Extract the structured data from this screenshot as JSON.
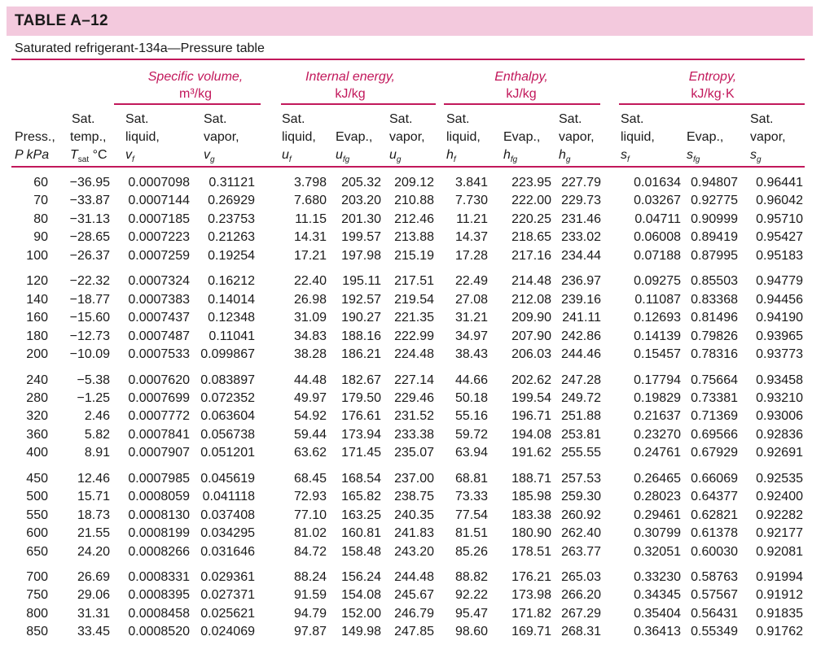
{
  "title": "TABLE A–12",
  "subtitle": "Saturated refrigerant-134a—Pressure table",
  "groups": {
    "specific_volume": {
      "name": "Specific volume,",
      "unit": "m³/kg"
    },
    "internal_energy": {
      "name": "Internal energy,",
      "unit": "kJ/kg"
    },
    "enthalpy": {
      "name": "Enthalpy,",
      "unit": "kJ/kg"
    },
    "entropy": {
      "name": "Entropy,",
      "unit": "kJ/kg·K"
    }
  },
  "headers": {
    "press": [
      "Press.,",
      "P kPa"
    ],
    "temp": [
      "Sat.",
      "temp.,",
      "T",
      "sat",
      " °C"
    ],
    "vf": [
      "Sat.",
      "liquid,",
      "v",
      "f"
    ],
    "vg": [
      "Sat.",
      "vapor,",
      "v",
      "g"
    ],
    "uf": [
      "Sat.",
      "liquid,",
      "u",
      "f"
    ],
    "ufg": [
      "Evap.,",
      "u",
      "fg"
    ],
    "ug": [
      "Sat.",
      "vapor,",
      "u",
      "g"
    ],
    "hf": [
      "Sat.",
      "liquid,",
      "h",
      "f"
    ],
    "hfg": [
      "Evap.,",
      "h",
      "fg"
    ],
    "hg": [
      "Sat.",
      "vapor,",
      "h",
      "g"
    ],
    "sf": [
      "Sat.",
      "liquid,",
      "s",
      "f"
    ],
    "sfg": [
      "Evap.,",
      "s",
      "fg"
    ],
    "sg": [
      "Sat.",
      "vapor,",
      "s",
      "g"
    ]
  },
  "rows": [
    [
      "60",
      "−36.95",
      "0.0007098",
      "0.31121",
      "3.798",
      "205.32",
      "209.12",
      "3.841",
      "223.95",
      "227.79",
      "0.01634",
      "0.94807",
      "0.96441"
    ],
    [
      "70",
      "−33.87",
      "0.0007144",
      "0.26929",
      "7.680",
      "203.20",
      "210.88",
      "7.730",
      "222.00",
      "229.73",
      "0.03267",
      "0.92775",
      "0.96042"
    ],
    [
      "80",
      "−31.13",
      "0.0007185",
      "0.23753",
      "11.15",
      "201.30",
      "212.46",
      "11.21",
      "220.25",
      "231.46",
      "0.04711",
      "0.90999",
      "0.95710"
    ],
    [
      "90",
      "−28.65",
      "0.0007223",
      "0.21263",
      "14.31",
      "199.57",
      "213.88",
      "14.37",
      "218.65",
      "233.02",
      "0.06008",
      "0.89419",
      "0.95427"
    ],
    [
      "100",
      "−26.37",
      "0.0007259",
      "0.19254",
      "17.21",
      "197.98",
      "215.19",
      "17.28",
      "217.16",
      "234.44",
      "0.07188",
      "0.87995",
      "0.95183"
    ],
    [
      "120",
      "−22.32",
      "0.0007324",
      "0.16212",
      "22.40",
      "195.11",
      "217.51",
      "22.49",
      "214.48",
      "236.97",
      "0.09275",
      "0.85503",
      "0.94779"
    ],
    [
      "140",
      "−18.77",
      "0.0007383",
      "0.14014",
      "26.98",
      "192.57",
      "219.54",
      "27.08",
      "212.08",
      "239.16",
      "0.11087",
      "0.83368",
      "0.94456"
    ],
    [
      "160",
      "−15.60",
      "0.0007437",
      "0.12348",
      "31.09",
      "190.27",
      "221.35",
      "31.21",
      "209.90",
      "241.11",
      "0.12693",
      "0.81496",
      "0.94190"
    ],
    [
      "180",
      "−12.73",
      "0.0007487",
      "0.11041",
      "34.83",
      "188.16",
      "222.99",
      "34.97",
      "207.90",
      "242.86",
      "0.14139",
      "0.79826",
      "0.93965"
    ],
    [
      "200",
      "−10.09",
      "0.0007533",
      "0.099867",
      "38.28",
      "186.21",
      "224.48",
      "38.43",
      "206.03",
      "244.46",
      "0.15457",
      "0.78316",
      "0.93773"
    ],
    [
      "240",
      "−5.38",
      "0.0007620",
      "0.083897",
      "44.48",
      "182.67",
      "227.14",
      "44.66",
      "202.62",
      "247.28",
      "0.17794",
      "0.75664",
      "0.93458"
    ],
    [
      "280",
      "−1.25",
      "0.0007699",
      "0.072352",
      "49.97",
      "179.50",
      "229.46",
      "50.18",
      "199.54",
      "249.72",
      "0.19829",
      "0.73381",
      "0.93210"
    ],
    [
      "320",
      "2.46",
      "0.0007772",
      "0.063604",
      "54.92",
      "176.61",
      "231.52",
      "55.16",
      "196.71",
      "251.88",
      "0.21637",
      "0.71369",
      "0.93006"
    ],
    [
      "360",
      "5.82",
      "0.0007841",
      "0.056738",
      "59.44",
      "173.94",
      "233.38",
      "59.72",
      "194.08",
      "253.81",
      "0.23270",
      "0.69566",
      "0.92836"
    ],
    [
      "400",
      "8.91",
      "0.0007907",
      "0.051201",
      "63.62",
      "171.45",
      "235.07",
      "63.94",
      "191.62",
      "255.55",
      "0.24761",
      "0.67929",
      "0.92691"
    ],
    [
      "450",
      "12.46",
      "0.0007985",
      "0.045619",
      "68.45",
      "168.54",
      "237.00",
      "68.81",
      "188.71",
      "257.53",
      "0.26465",
      "0.66069",
      "0.92535"
    ],
    [
      "500",
      "15.71",
      "0.0008059",
      "0.041118",
      "72.93",
      "165.82",
      "238.75",
      "73.33",
      "185.98",
      "259.30",
      "0.28023",
      "0.64377",
      "0.92400"
    ],
    [
      "550",
      "18.73",
      "0.0008130",
      "0.037408",
      "77.10",
      "163.25",
      "240.35",
      "77.54",
      "183.38",
      "260.92",
      "0.29461",
      "0.62821",
      "0.92282"
    ],
    [
      "600",
      "21.55",
      "0.0008199",
      "0.034295",
      "81.02",
      "160.81",
      "241.83",
      "81.51",
      "180.90",
      "262.40",
      "0.30799",
      "0.61378",
      "0.92177"
    ],
    [
      "650",
      "24.20",
      "0.0008266",
      "0.031646",
      "84.72",
      "158.48",
      "243.20",
      "85.26",
      "178.51",
      "263.77",
      "0.32051",
      "0.60030",
      "0.92081"
    ],
    [
      "700",
      "26.69",
      "0.0008331",
      "0.029361",
      "88.24",
      "156.24",
      "244.48",
      "88.82",
      "176.21",
      "265.03",
      "0.33230",
      "0.58763",
      "0.91994"
    ],
    [
      "750",
      "29.06",
      "0.0008395",
      "0.027371",
      "91.59",
      "154.08",
      "245.67",
      "92.22",
      "173.98",
      "266.20",
      "0.34345",
      "0.57567",
      "0.91912"
    ],
    [
      "800",
      "31.31",
      "0.0008458",
      "0.025621",
      "94.79",
      "152.00",
      "246.79",
      "95.47",
      "171.82",
      "267.29",
      "0.35404",
      "0.56431",
      "0.91835"
    ],
    [
      "850",
      "33.45",
      "0.0008520",
      "0.024069",
      "97.87",
      "149.98",
      "247.85",
      "98.60",
      "169.71",
      "268.31",
      "0.36413",
      "0.55349",
      "0.91762"
    ]
  ]
}
